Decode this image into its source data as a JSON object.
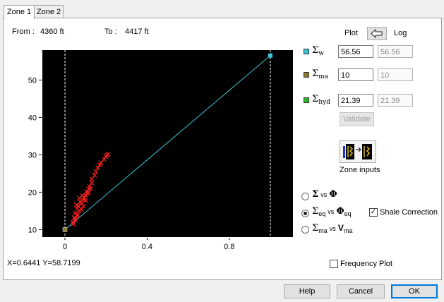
{
  "tabs": [
    {
      "label": "Zone 1"
    },
    {
      "label": "Zone 2"
    }
  ],
  "header": {
    "from_label": "From :",
    "from_value": "4360 ft",
    "to_label": "To :",
    "to_value": "4417 ft"
  },
  "controls": {
    "plot_label": "Plot",
    "log_label": "Log",
    "sigma_w": {
      "plot_value": "56.56",
      "log_value": "56.56",
      "color": "#38c8d8"
    },
    "sigma_ma": {
      "plot_value": "10",
      "log_value": "10",
      "color": "#8a7a30"
    },
    "sigma_hyd": {
      "plot_value": "21.39",
      "log_value": "21.39",
      "color": "#28b828"
    },
    "validate_label": "Validate",
    "zone_inputs_label": "Zone inputs"
  },
  "options": {
    "vs": "vs",
    "radio_sigma_phi": "Σ vs Φ",
    "radio_eq": "Σeq vs Φeq",
    "radio_ma": "Σma vs Vma",
    "shale_correction_label": "Shale Correction",
    "frequency_plot_label": "Frequency Plot"
  },
  "status": {
    "coords": "X=0.6441 Y=58.7199"
  },
  "buttons": {
    "help": "Help",
    "cancel": "Cancel",
    "ok": "OK"
  },
  "chart_data": {
    "type": "scatter",
    "background": "#000000",
    "x_ticks": [
      "0",
      "0.4",
      "0.8"
    ],
    "y_ticks": [
      "10",
      "20",
      "30",
      "40",
      "50"
    ],
    "xlim": [
      -0.11,
      1.11
    ],
    "ylim": [
      8,
      58
    ],
    "vertical_lines_x": [
      0,
      1
    ],
    "line": {
      "from": [
        0,
        10
      ],
      "to": [
        1,
        56.56
      ],
      "color": "#38c8d8"
    },
    "endpoint_water": [
      1,
      56.56
    ],
    "endpoint_matrix": [
      0,
      10
    ],
    "points": [
      [
        0.04,
        12.0
      ],
      [
        0.05,
        12.6
      ],
      [
        0.045,
        13.2
      ],
      [
        0.06,
        13.8
      ],
      [
        0.05,
        14.4
      ],
      [
        0.07,
        15.0
      ],
      [
        0.06,
        15.6
      ],
      [
        0.065,
        16.3
      ],
      [
        0.08,
        16.9
      ],
      [
        0.075,
        17.4
      ],
      [
        0.09,
        18.0
      ],
      [
        0.095,
        18.6
      ],
      [
        0.1,
        19.2
      ],
      [
        0.11,
        19.6
      ],
      [
        0.105,
        20.2
      ],
      [
        0.115,
        20.8
      ],
      [
        0.12,
        21.5
      ],
      [
        0.13,
        22.5
      ],
      [
        0.13,
        23.5
      ],
      [
        0.145,
        24.5
      ],
      [
        0.15,
        25.5
      ],
      [
        0.16,
        26.5
      ],
      [
        0.17,
        27.3
      ],
      [
        0.175,
        27.9
      ],
      [
        0.19,
        28.8
      ],
      [
        0.2,
        29.5
      ],
      [
        0.21,
        30.2
      ],
      [
        0.205,
        29.9
      ],
      [
        0.055,
        16.6
      ],
      [
        0.07,
        18.4
      ],
      [
        0.085,
        19.1
      ],
      [
        0.1,
        17.8
      ],
      [
        0.115,
        20.0
      ],
      [
        0.125,
        21.0
      ],
      [
        0.09,
        16.3
      ],
      [
        0.08,
        15.4
      ],
      [
        0.06,
        14.0
      ],
      [
        0.05,
        13.0
      ],
      [
        0.04,
        11.5
      ]
    ],
    "point_color": "#ff2020"
  }
}
